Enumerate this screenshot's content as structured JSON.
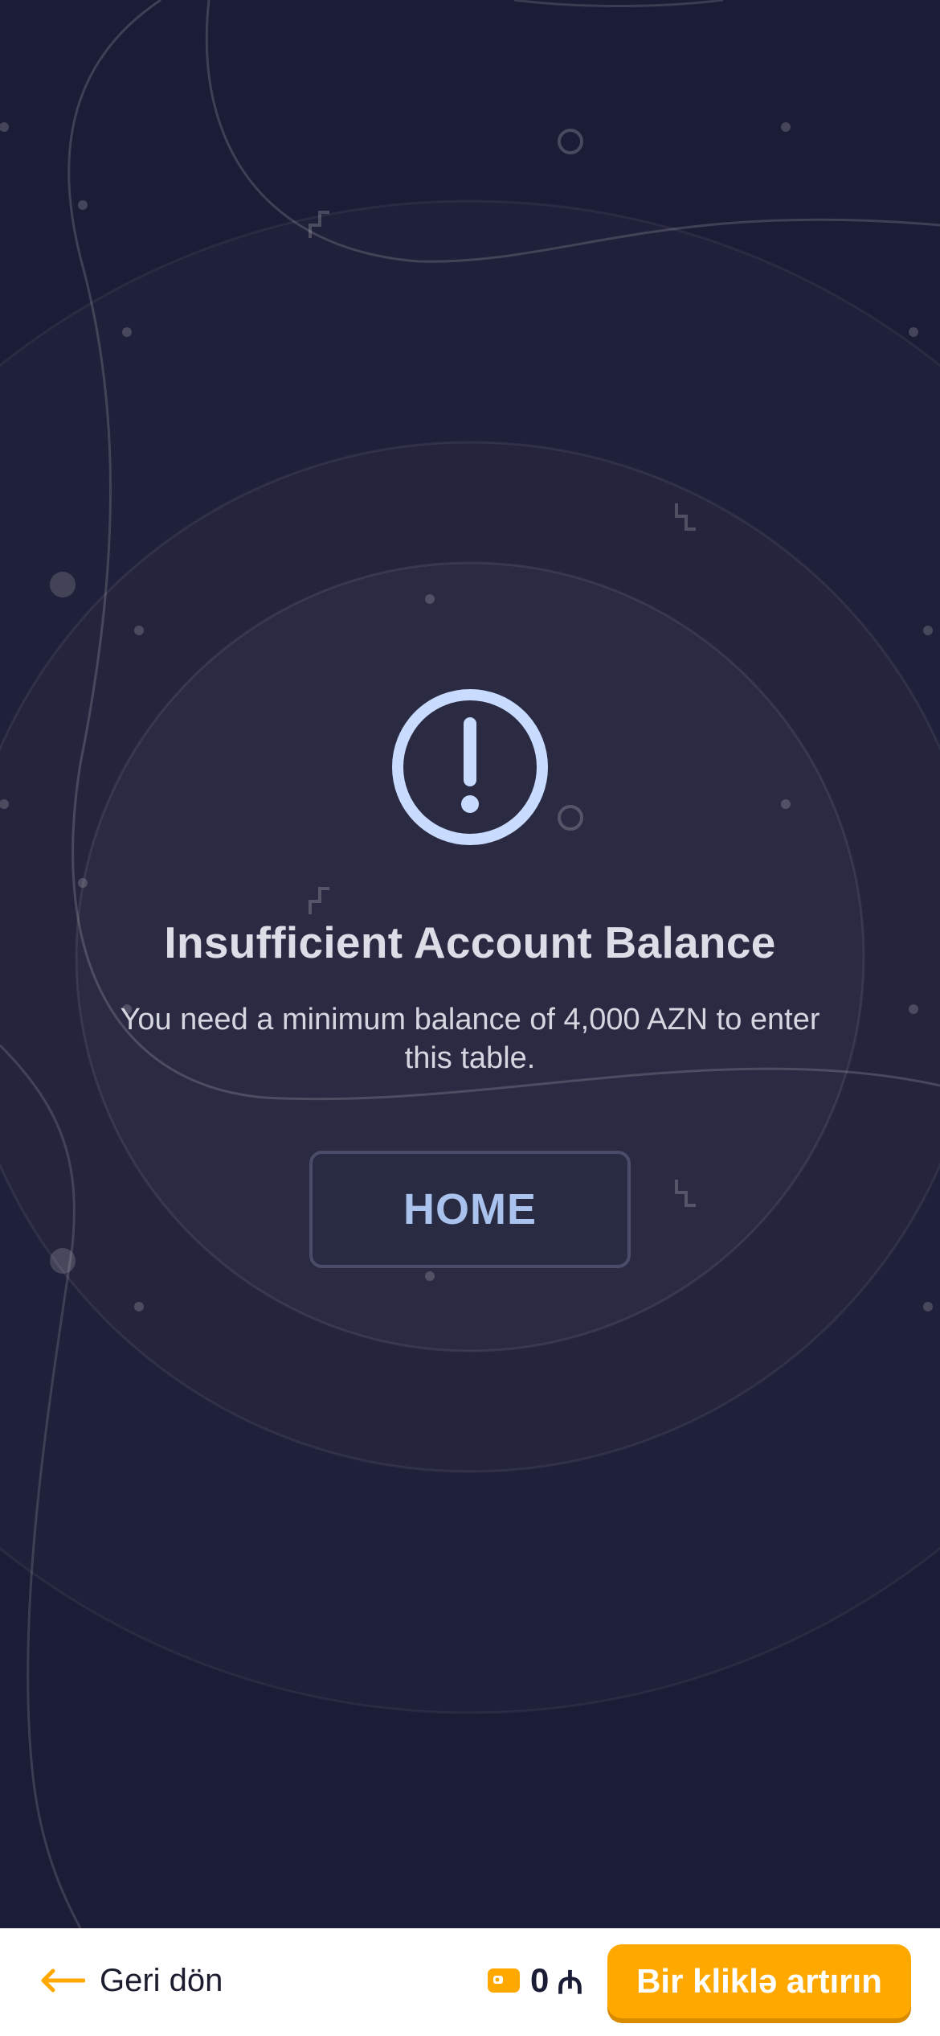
{
  "alert": {
    "icon": "exclamation-circle-icon",
    "title": "Insufficient Account Balance",
    "message": "You need a minimum balance of 4,000 AZN to enter this table.",
    "home_label": "HOME"
  },
  "bottom_bar": {
    "back_icon": "arrow-left-icon",
    "back_label": "Geri dön",
    "wallet_icon": "wallet-icon",
    "balance_value": "0",
    "balance_currency": "₼",
    "deposit_label": "Bir kliklə artırın"
  },
  "colors": {
    "background": "#1b1c36",
    "accent": "#ffa900",
    "icon": "#c9dcff",
    "home_text": "#a9c2ee"
  }
}
